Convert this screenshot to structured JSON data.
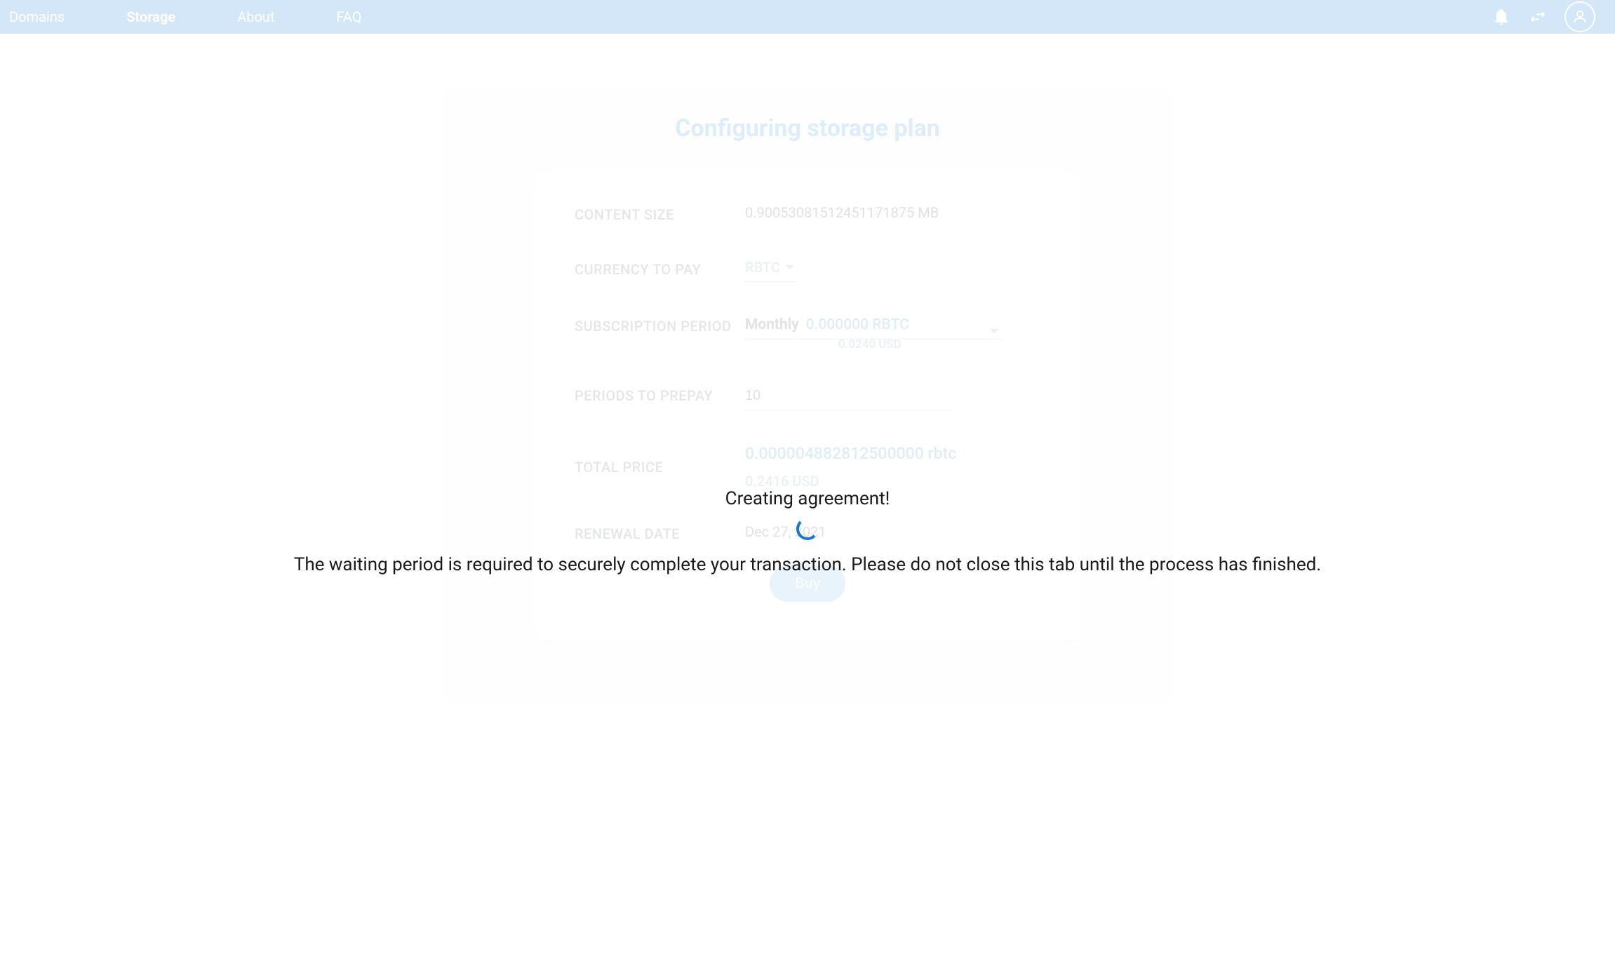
{
  "nav": {
    "domains": "Domains",
    "storage": "Storage",
    "about": "About",
    "faq": "FAQ"
  },
  "card": {
    "title": "Configuring storage plan"
  },
  "form": {
    "content_size": {
      "label": "CONTENT SIZE",
      "value": "0.90053081512451171875 MB"
    },
    "currency": {
      "label": "CURRENCY TO PAY",
      "value": "RBTC"
    },
    "period": {
      "label": "SUBSCRIPTION PERIOD",
      "period": "Monthly",
      "price": "0.000000 RBTC",
      "price_usd": "0.0240 USD"
    },
    "prepay": {
      "label": "PERIODS TO PREPAY",
      "value": "10"
    },
    "total": {
      "label": "TOTAL PRICE",
      "main": "0.000004882812500000 rbtc",
      "sub": "0.2416 USD"
    },
    "renewal": {
      "label": "RENEWAL DATE",
      "value": "Dec 27, 2021"
    },
    "buy": "Buy"
  },
  "overlay": {
    "title": "Creating agreement!",
    "text": "The waiting period is required to securely complete your transaction. Please do not close this tab until the process has finished."
  }
}
